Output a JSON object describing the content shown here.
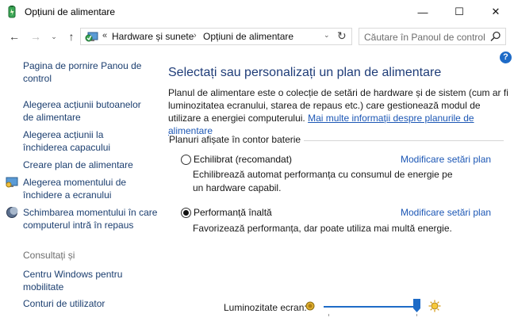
{
  "window": {
    "title": "Opțiuni de alimentare",
    "minimize_glyph": "—",
    "maximize_glyph": "☐",
    "close_glyph": "✕"
  },
  "nav": {
    "back_glyph": "←",
    "forward_glyph": "→",
    "recent_glyph": "⌄",
    "up_glyph": "↑",
    "address_chevron": "«",
    "breadcrumbs": [
      "Hardware și sunete",
      "Opțiuni de alimentare"
    ],
    "breadcrumb_sep": "›",
    "dropdown_glyph": "⌄",
    "refresh_glyph": "↻",
    "search_placeholder": "Căutare în Panoul de control"
  },
  "sidebar": {
    "items": [
      {
        "label": "Pagina de pornire Panou de control"
      },
      {
        "label": "Alegerea acțiunii butoanelor de alimentare"
      },
      {
        "label": "Alegerea acțiunii la închiderea capacului"
      },
      {
        "label": "Creare plan de alimentare"
      },
      {
        "label": "Alegerea momentului de închidere a ecranului",
        "icon": "display-icon"
      },
      {
        "label": "Schimbarea momentului în care computerul intră în repaus",
        "icon": "moon-icon"
      }
    ],
    "see_also_heading": "Consultați și",
    "see_also": [
      {
        "label": "Centru Windows pentru mobilitate"
      },
      {
        "label": "Conturi de utilizator"
      }
    ]
  },
  "main": {
    "help_glyph": "?",
    "title": "Selectați sau personalizați un plan de alimentare",
    "description": "Planul de alimentare este o colecție de setări de hardware și de sistem (cum ar fi luminozitatea ecranului, starea de repaus etc.) care gestionează modul de utilizare a energiei computerului.",
    "description_link": "Mai multe informații despre planurile de alimentare",
    "group_label": "Planuri afișate în contor baterie",
    "plans": [
      {
        "name": "Echilibrat (recomandat)",
        "selected": false,
        "link": "Modificare setări plan",
        "description": "Echilibrează automat performanța cu consumul de energie pe un hardware capabil."
      },
      {
        "name": "Performanță înaltă",
        "selected": true,
        "link": "Modificare setări plan",
        "description": "Favorizează performanța, dar poate utiliza mai multă energie."
      }
    ]
  },
  "brightness": {
    "label": "Luminozitate ecran:",
    "value_fraction": 0.98
  },
  "colors": {
    "link": "#1b3e6f",
    "accent": "#1e6bc7",
    "title": "#1e3c78"
  }
}
